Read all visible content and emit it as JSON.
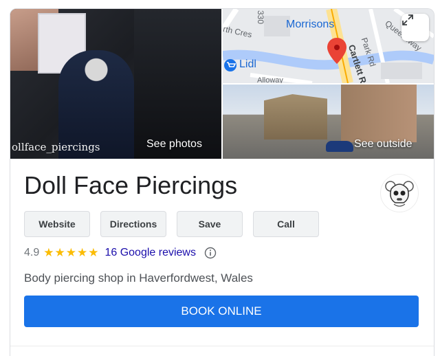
{
  "photos": {
    "main_label": "See photos",
    "watermark": "ollface_piercings",
    "street_label": "See outside"
  },
  "map": {
    "labels": [
      "Morrisons",
      "Lidl",
      "Park Rd",
      "Cartlett R",
      "Queensway",
      "rth Cres",
      "330",
      "Alloway"
    ],
    "expand_icon": "expand-icon",
    "pin_color": "#ea4335"
  },
  "business": {
    "name": "Doll Face Piercings",
    "logo_icon": "skull-logo",
    "rating": "4.9",
    "stars": "★★★★★",
    "star_count": 5,
    "reviews_label": "16 Google reviews",
    "category": "Body piercing shop in Haverfordwest, Wales"
  },
  "actions": {
    "website": "Website",
    "directions": "Directions",
    "save": "Save",
    "call": "Call"
  },
  "booking": {
    "label": "BOOK ONLINE",
    "color": "#1a73e8"
  },
  "colors": {
    "star": "#fbbc04",
    "link": "#1a0dab"
  }
}
